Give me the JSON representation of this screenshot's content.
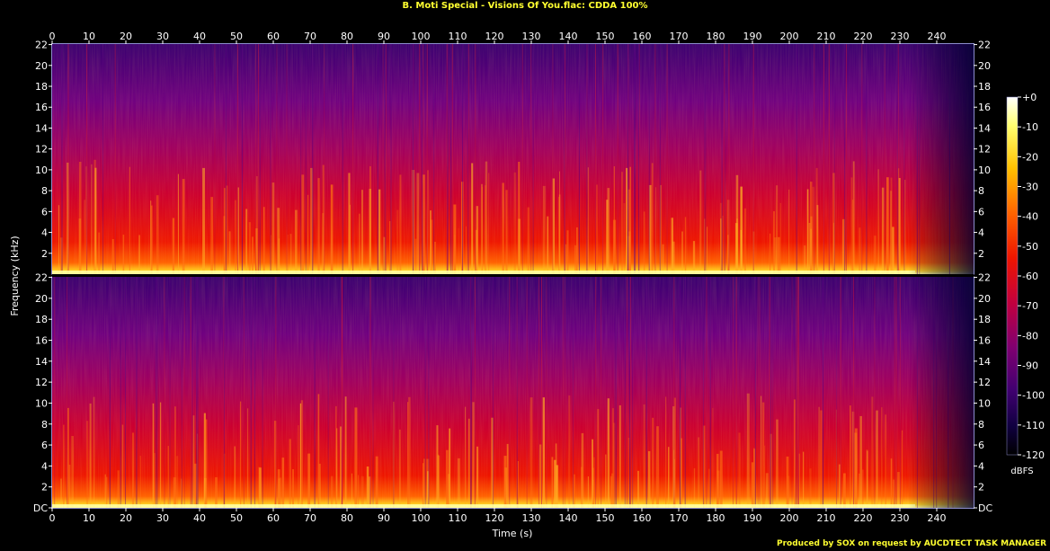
{
  "title": "B. Moti Special - Visions Of You.flac: CDDA 100%",
  "footer": "Produced by SOX on request by AUCDTECT TASK MANAGER",
  "chart_data": {
    "type": "heatmap",
    "title": "B. Moti Special - Visions Of You.flac: CDDA 100%",
    "xlabel": "Time (s)",
    "ylabel": "Frequency (kHz)",
    "x_ticks": [
      "0",
      "10",
      "20",
      "30",
      "40",
      "50",
      "60",
      "70",
      "80",
      "90",
      "100",
      "110",
      "120",
      "130",
      "140",
      "150",
      "160",
      "170",
      "180",
      "190",
      "200",
      "210",
      "220",
      "230",
      "240"
    ],
    "xlim": [
      0,
      250
    ],
    "y_ticks_channel": [
      "DC",
      "2",
      "4",
      "6",
      "8",
      "10",
      "12",
      "14",
      "16",
      "18",
      "20",
      "22"
    ],
    "ylim_khz": [
      0,
      22.05
    ],
    "channels": 2,
    "colorbar": {
      "label": "dBFS",
      "ticks": [
        "+0",
        "-10",
        "-20",
        "-30",
        "-40",
        "-50",
        "-60",
        "-70",
        "-80",
        "-90",
        "-100",
        "-110",
        "-120"
      ],
      "range": [
        -120,
        0
      ]
    },
    "colors": {
      "title": "#ffff30",
      "axes_frame": "#8c8ccc",
      "text": "#ffffff"
    }
  }
}
